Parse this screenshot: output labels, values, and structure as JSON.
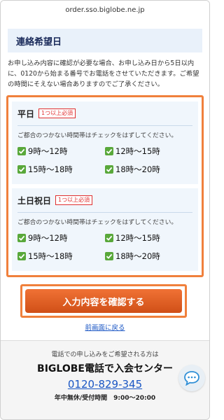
{
  "browser": {
    "url": "order.sso.biglobe.ne.jp"
  },
  "section": {
    "title": "連絡希望日",
    "intro": "お申し込み内容に確認が必要な場合、お申し込み日から5日以内に、0120から始まる番号でお電話をさせていただきます。ご希望の時間にそえない場合ありますのでご了承ください。"
  },
  "weekday": {
    "title": "平日",
    "required_badge": "1つ以上必須",
    "hint": "ご都合のつかない時間帯はチェックをはずしてください。",
    "options": [
      "9時〜12時",
      "12時〜15時",
      "15時〜18時",
      "18時〜20時"
    ]
  },
  "weekend": {
    "title": "土日祝日",
    "required_badge": "1つ以上必須",
    "hint": "ご都合のつかない時間帯はチェックをはずしてください。",
    "options": [
      "9時〜12時",
      "12時〜15時",
      "15時〜18時",
      "18時〜20時"
    ]
  },
  "actions": {
    "confirm_label": "入力内容を確認する",
    "back_label": "前画面に戻る"
  },
  "footer": {
    "lead": "電話での申し込みをご希望される方は",
    "center_name": "BIGLOBE電話で入会センター",
    "phone": "0120-829-345",
    "hours": "年中無休/受付時間　9:00〜20:00"
  },
  "colors": {
    "accent": "#f0803c",
    "checkbox": "#59a83a",
    "link": "#1a56c4",
    "cta": "#e05f22"
  },
  "icons": {
    "chat": "chat-bubble-icon",
    "check": "check-icon"
  }
}
